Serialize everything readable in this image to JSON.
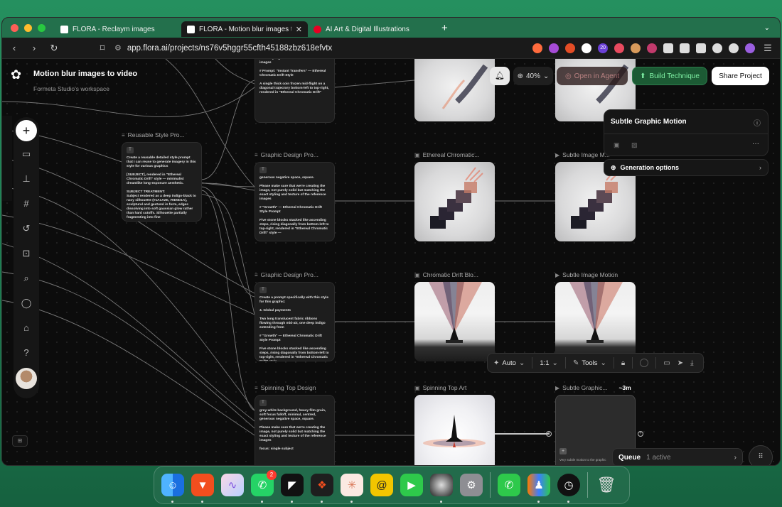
{
  "browser": {
    "tabs": [
      {
        "title": "FLORA - Reclaym images",
        "icon": "flora-icon"
      },
      {
        "title": "FLORA - Motion blur images to video",
        "icon": "flora-icon",
        "active": true
      },
      {
        "title": "AI Art & Digital Illustrations",
        "icon": "pinterest-icon"
      }
    ],
    "url": "app.flora.ai/projects/ns76v5hggr55cfth45188zbz618efvtx",
    "extension_badge": "20"
  },
  "project": {
    "title": "Motion blur images to video",
    "workspace": "Formeta Studio's workspace"
  },
  "topbar": {
    "zoom": "40%",
    "open_in_agent": "Open in Agent",
    "build_technique": "Build Technique",
    "share": "Share Project"
  },
  "panel": {
    "title": "Subtle Graphic Motion",
    "generation_options": "Generation options"
  },
  "nodes": {
    "reusable": {
      "label": "Reusable Style Pro...",
      "text": "Create a reusable detailed style prompt that I can reuse to generate imagery in this style for various graphics\n\n[SUBJECT], rendered in \"Ethereal Chromatic Drift\" style — minimalist dreamlike long-exposure aesthetic.\n\nSUBJECT TREATMENT:\nSubject rendered as a deep indigo-black to navy silhouette (#1A1A2E, #0D0D1A), sculptural and gestural in form, edges dissolving into soft gaussian glow rather than hard cutoffs. Silhouette partially fragmenting into fine"
    },
    "top_prompt": {
      "text": "exact styling and texture of the reference images\n\n# Prompt: \"Instant Transfers\" — Ethereal Chromatic Drift Style\n\nA single thick coin frozen mid-flight on a diagonal trajectory bottom-left to top-right, rendered in \"Ethereal Chromatic Drift\""
    },
    "design1": {
      "label": "Graphic Design Pro...",
      "text": "generous negative space, square.\n\nPlease make sure that we're creating the image, not purely solid but matching the exact styling and texture of the reference images\n\n# \"Growth\" — Ethereal Chromatic Drift Style Prompt\n\nFive stone blocks stacked like ascending steps, rising diagonally from bottom-left to top-right, rendered in \"Ethereal Chromatic Drift\" style —"
    },
    "design2": {
      "label": "Graphic Design Pro...",
      "text": "Create a prompt specifically with this style for this graphic:\n\n4. Global payments\n\nTwo long translucent fabric ribbons flowing through mid-air, one deep indigo extending from\n\n# \"Growth\" — Ethereal Chromatic Drift Style Prompt\n\nFive stone blocks stacked like ascending steps, rising diagonally from bottom-left to top-right, rendered in \"Ethereal Chromatic Drift\" style —"
    },
    "spin_design": {
      "label": "Spinning Top Design",
      "text": "grey-white background, heavy film grain, soft focus falloff, minimal, centred, generous negative space, square.\n\nPlease make sure that we're creating the image, not purely solid but matching the exact styling and texture of the reference images\n\nfocus: single subject"
    },
    "ethereal": {
      "label": "Ethereal Chromatic..."
    },
    "subtle1": {
      "label": "Subtle Image M..."
    },
    "chromatic": {
      "label": "Chromatic Drift Blo..."
    },
    "subtle2": {
      "label": "Subtle Image Motion"
    },
    "spin_art": {
      "label": "Spinning Top Art"
    },
    "subtle3": {
      "label": "Subtle Graphic...",
      "duration": "~3m",
      "note": "Very subtle motion to the graphic"
    }
  },
  "floatbar": {
    "mode": "Auto",
    "ratio": "1:1",
    "tools": "Tools"
  },
  "queue": {
    "label": "Queue",
    "count": "1 active"
  },
  "dock": {
    "whatsapp_badge": "2",
    "apps": [
      "finder-icon",
      "brave-icon",
      "arc-icon",
      "whatsapp-icon",
      "framer-icon",
      "figma-icon",
      "claude-icon",
      "spiral-icon",
      "facetime-icon",
      "orb-icon",
      "settings-icon",
      "phone-icon",
      "people-icon",
      "clock-icon",
      "trash-icon"
    ]
  },
  "colors": {
    "accent_green": "#1c5a34",
    "canvas": "#0c0c0c",
    "desktop": "#1f7a55"
  }
}
